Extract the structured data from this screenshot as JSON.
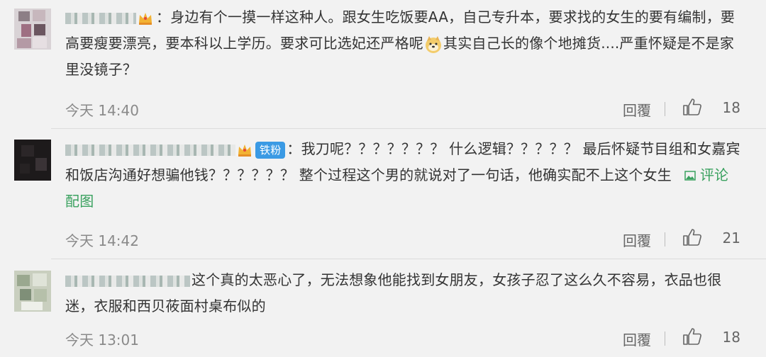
{
  "comments": [
    {
      "text_before": "：身边有个一摸一样这种人。跟女生吃饭要AA，自己专升本，要求找的女生的要有编制，要高要瘦要漂亮，要本科以上学历。要求可比选妃还严格呢",
      "text_after": "其实自己长的像个地摊货....严重怀疑是不是家里没镜子？",
      "emoji_icon": "doge-emoji-icon",
      "time": "今天 14:40",
      "reply_label": "回覆",
      "likes": "18"
    },
    {
      "badge": "铁粉",
      "text": "：我刀呢？？？？？？？ 什么逻辑？？？？？ 最后怀疑节目组和女嘉宾和饭店沟通好想骗他钱？？？？？？ 整个过程这个男的就说对了一句话，他确实配不上这个女生",
      "pic_link": "评论配图",
      "time": "今天 14:42",
      "reply_label": "回覆",
      "likes": "21"
    },
    {
      "text": "这个真的太恶心了，无法想象他能找到女朋友，女孩子忍了这么久不容易，衣品也很迷，衣服和西贝莜面村桌布似的",
      "time": "今天 13:01",
      "reply_label": "回覆",
      "likes": "18"
    }
  ],
  "colors": {
    "background": "#f2f2f2",
    "badge_blue": "#3b9ae4",
    "link_green": "#3aa15f",
    "meta_gray": "#8a8a8a"
  }
}
